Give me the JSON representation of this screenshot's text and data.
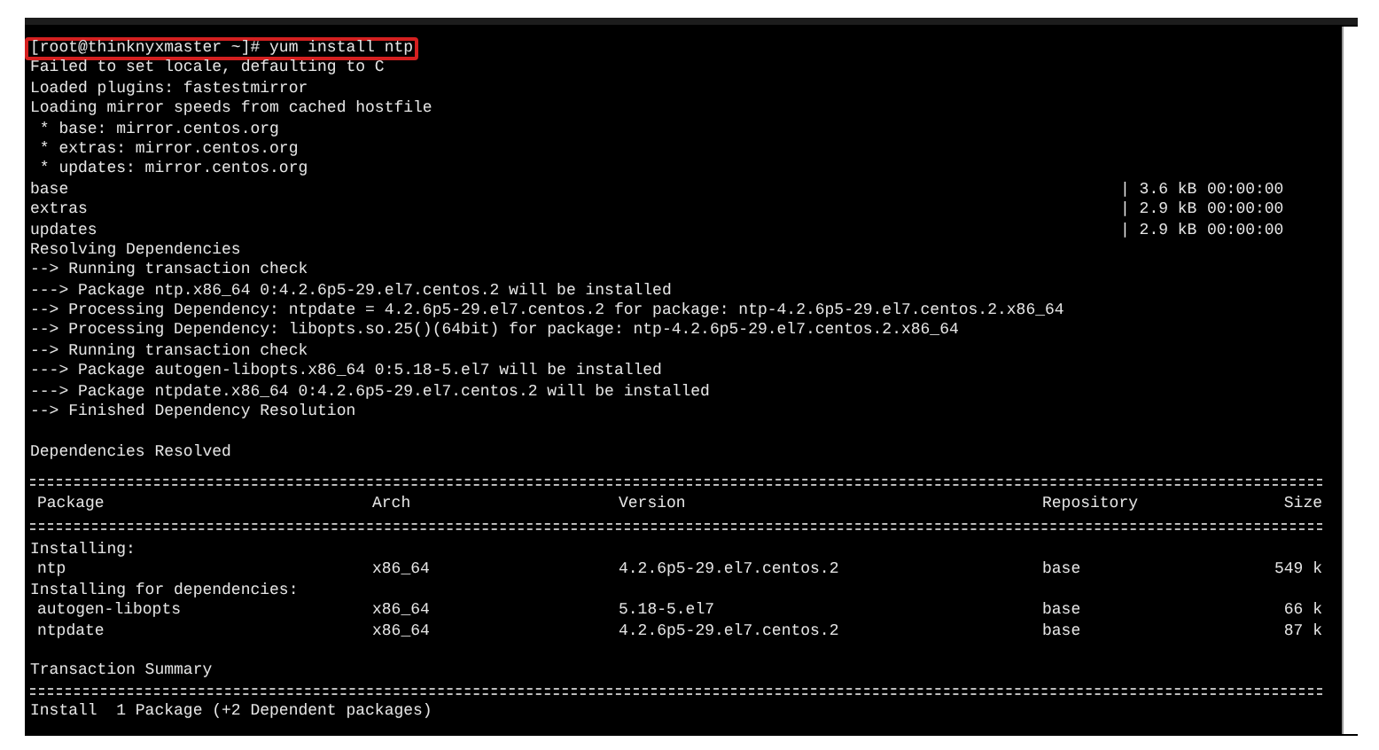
{
  "command": {
    "text": "[root@thinknyxmaster ~]# yum install ntp",
    "highlighted": true
  },
  "log": [
    {
      "kind": "text",
      "text": "Failed to set locale, defaulting to C"
    },
    {
      "kind": "text",
      "text": "Loaded plugins: fastestmirror"
    },
    {
      "kind": "text",
      "text": "Loading mirror speeds from cached hostfile"
    },
    {
      "kind": "text",
      "text": " * base: mirror.centos.org"
    },
    {
      "kind": "text",
      "text": " * extras: mirror.centos.org"
    },
    {
      "kind": "text",
      "text": " * updates: mirror.centos.org"
    },
    {
      "kind": "repo",
      "text": "base",
      "size": "| 3.6 kB",
      "time": "00:00:00"
    },
    {
      "kind": "repo",
      "text": "extras",
      "size": "| 2.9 kB",
      "time": "00:00:00"
    },
    {
      "kind": "repo",
      "text": "updates",
      "size": "| 2.9 kB",
      "time": "00:00:00"
    },
    {
      "kind": "text",
      "text": "Resolving Dependencies"
    },
    {
      "kind": "text",
      "text": "--> Running transaction check"
    },
    {
      "kind": "text",
      "text": "---> Package ntp.x86_64 0:4.2.6p5-29.el7.centos.2 will be installed"
    },
    {
      "kind": "text",
      "text": "--> Processing Dependency: ntpdate = 4.2.6p5-29.el7.centos.2 for package: ntp-4.2.6p5-29.el7.centos.2.x86_64"
    },
    {
      "kind": "text",
      "text": "--> Processing Dependency: libopts.so.25()(64bit) for package: ntp-4.2.6p5-29.el7.centos.2.x86_64"
    },
    {
      "kind": "text",
      "text": "--> Running transaction check"
    },
    {
      "kind": "text",
      "text": "---> Package autogen-libopts.x86_64 0:5.18-5.el7 will be installed"
    },
    {
      "kind": "text",
      "text": "---> Package ntpdate.x86_64 0:4.2.6p5-29.el7.centos.2 will be installed"
    },
    {
      "kind": "text",
      "text": "--> Finished Dependency Resolution"
    }
  ],
  "resolved_message": "Dependencies Resolved",
  "table": {
    "columns": [
      "Package",
      "Arch",
      "Version",
      "Repository",
      "Size"
    ],
    "sections": [
      {
        "title": "Installing:",
        "rows": [
          [
            "ntp",
            "x86_64",
            "4.2.6p5-29.el7.centos.2",
            "base",
            "549 k"
          ]
        ]
      },
      {
        "title": "Installing for dependencies:",
        "rows": [
          [
            "autogen-libopts",
            "x86_64",
            "5.18-5.el7",
            "base",
            "66 k"
          ],
          [
            "ntpdate",
            "x86_64",
            "4.2.6p5-29.el7.centos.2",
            "base",
            "87 k"
          ]
        ]
      }
    ]
  },
  "summary_title": "Transaction Summary",
  "summary_line": "Install  1 Package (+2 Dependent packages)"
}
